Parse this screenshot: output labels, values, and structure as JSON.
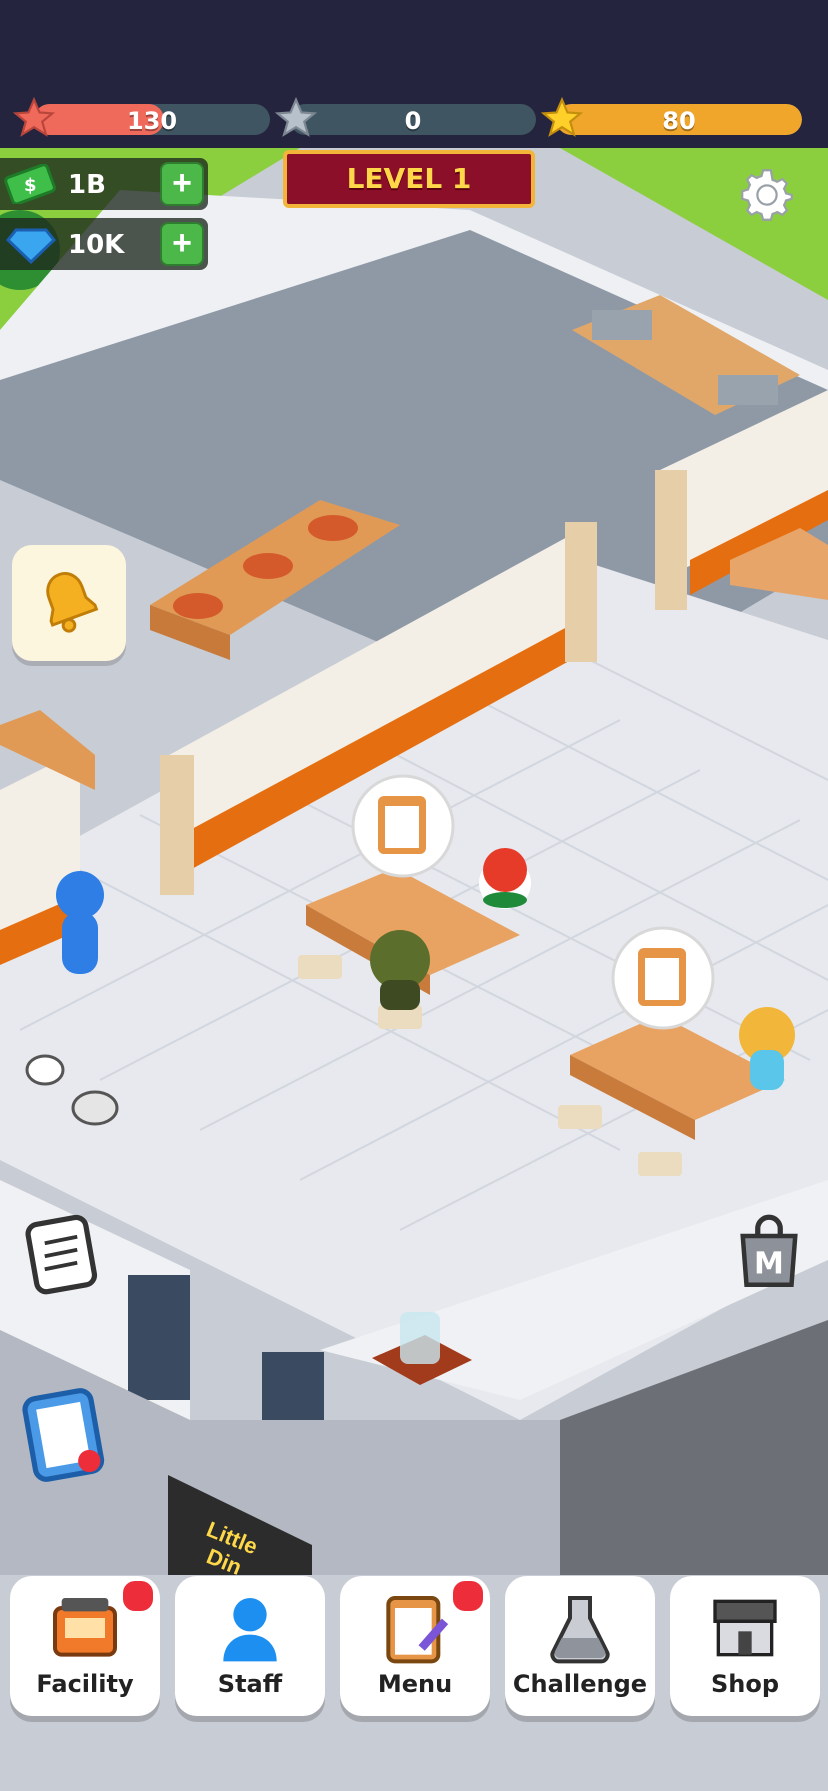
{
  "hud": {
    "meters": [
      {
        "name": "red-star-meter",
        "value": "130",
        "fill": 0.55,
        "color": "#f06a5c"
      },
      {
        "name": "silver-star-meter",
        "value": "0",
        "fill": 0.0,
        "color": "#9aa3b0"
      },
      {
        "name": "gold-star-meter",
        "value": "80",
        "fill": 1.0,
        "color": "#f0a52b"
      }
    ],
    "level_label": "LEVEL 1",
    "cash": "1B",
    "gems": "10K"
  },
  "world": {
    "sign_text_1": "Little",
    "sign_text_2": "Din"
  },
  "nav": {
    "items": [
      {
        "label": "Facility",
        "badge": true
      },
      {
        "label": "Staff",
        "badge": false
      },
      {
        "label": "Menu",
        "badge": true
      },
      {
        "label": "Challenge",
        "badge": false
      },
      {
        "label": "Shop",
        "badge": false
      }
    ]
  },
  "colors": {
    "topbar": "#24243f",
    "accent_orange": "#f07a10",
    "plus_green": "#4cb84a",
    "level_bg": "#8c0f2a"
  }
}
